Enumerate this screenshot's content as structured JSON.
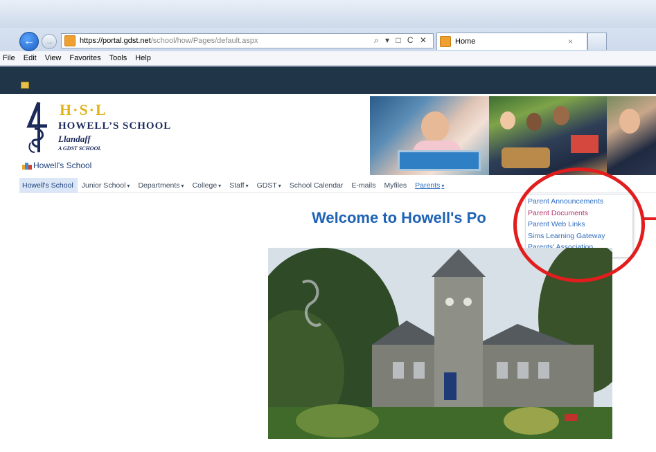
{
  "browser": {
    "url_host": "https://portal.gdst.net",
    "url_path": "/school/how/Pages/default.aspx",
    "address_icons": "⌕ ▾ □ C ✕",
    "tab_title": "Home",
    "tab_close": "×",
    "menu": [
      "File",
      "Edit",
      "View",
      "Favorites",
      "Tools",
      "Help"
    ]
  },
  "header": {
    "logo_letters": "H·S·L",
    "school_name": "HOWELL’S SCHOOL",
    "town": "Llandaff",
    "tagline": "A GDST SCHOOL",
    "site_title": "Howell's School"
  },
  "nav": {
    "items": [
      {
        "label": "Howell's School",
        "dropdown": false
      },
      {
        "label": "Junior School",
        "dropdown": true
      },
      {
        "label": "Departments",
        "dropdown": true
      },
      {
        "label": "College",
        "dropdown": true
      },
      {
        "label": "Staff",
        "dropdown": true
      },
      {
        "label": "GDST",
        "dropdown": true
      },
      {
        "label": "School Calendar",
        "dropdown": false
      },
      {
        "label": "E-mails",
        "dropdown": false
      },
      {
        "label": "Myfiles",
        "dropdown": false
      },
      {
        "label": "Parents",
        "dropdown": true
      }
    ],
    "caret": "▾"
  },
  "parents_menu": {
    "items": [
      "Parent Announcements",
      "Parent Documents",
      "Parent Web Links",
      "Sims Learning Gateway",
      "Parents' Association"
    ]
  },
  "main": {
    "welcome": "Welcome to Howell's Po"
  },
  "colors": {
    "accent_blue": "#1f63b5",
    "link_blue": "#2e6dbf",
    "hover_pink": "#b1316b",
    "highlight_red": "#e21d1d",
    "dark_bar": "#213548",
    "logo_gold": "#e2b31c"
  }
}
